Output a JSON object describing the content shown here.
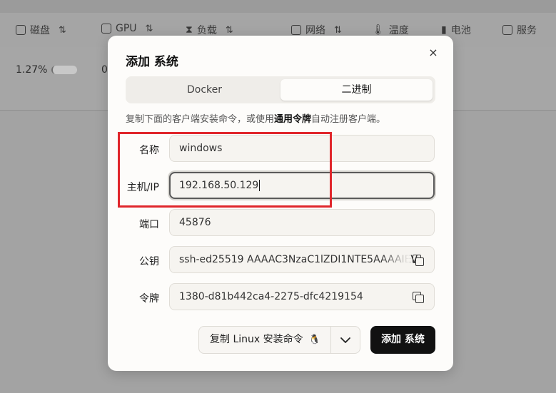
{
  "background": {
    "columns": [
      {
        "label": "磁盘",
        "icon": "disk-icon"
      },
      {
        "label": "GPU",
        "icon": "gpu-icon"
      },
      {
        "label": "负载",
        "icon": "hourglass-icon"
      },
      {
        "label": "网络",
        "icon": "network-icon"
      },
      {
        "label": "温度",
        "icon": "thermometer-icon"
      },
      {
        "label": "电池",
        "icon": "battery-icon"
      },
      {
        "label": "服务",
        "icon": "services-icon"
      }
    ],
    "row": {
      "disk_value": "1.27%",
      "disk_fill": 0.05,
      "gpu_value": "0"
    }
  },
  "modal": {
    "title": "添加 系统",
    "close_label": "×",
    "tabs": [
      {
        "label": "Docker",
        "selected": false
      },
      {
        "label": "二进制",
        "selected": true
      }
    ],
    "description_prefix": "复制下面的客户端安装命令，或使用",
    "description_link": "通用令牌",
    "description_suffix": "自动注册客户端。",
    "fields": {
      "name": {
        "label": "名称",
        "value": "windows"
      },
      "host": {
        "label": "主机/IP",
        "value": "192.168.50.129"
      },
      "port": {
        "label": "端口",
        "value": "45876"
      },
      "pubkey": {
        "label": "公钥",
        "value": "ssh-ed25519 AAAAC3NzaC1lZDI1NTE5AAAAIEV"
      },
      "token": {
        "label": "令牌",
        "value": "1380-d81b442ca4-2275-dfc4219154"
      }
    },
    "copy_linux_label": "复制 Linux 安装命令",
    "add_button_label": "添加 系统"
  }
}
